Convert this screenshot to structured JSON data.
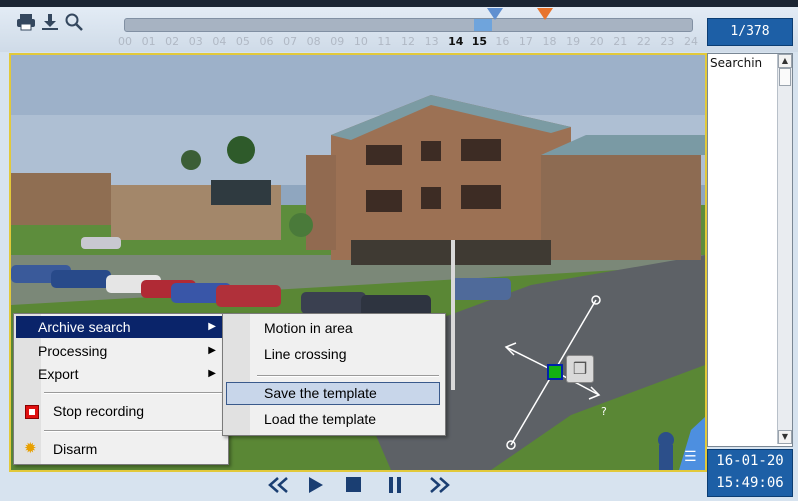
{
  "toolbar": {
    "icons": [
      "print-icon",
      "download-icon",
      "search-icon"
    ]
  },
  "timeline": {
    "hours": [
      "00",
      "01",
      "02",
      "03",
      "04",
      "05",
      "06",
      "07",
      "08",
      "09",
      "10",
      "11",
      "12",
      "13",
      "14",
      "15",
      "16",
      "17",
      "18",
      "19",
      "20",
      "21",
      "22",
      "23",
      "24"
    ],
    "highlighted_hours": [
      "14",
      "15"
    ],
    "marker_blue_color": "#5f8fd0",
    "marker_orange_color": "#e8742c"
  },
  "counter": {
    "value": "1/378"
  },
  "search_panel": {
    "text": "Searchin"
  },
  "datetime": {
    "date": "16-01-20",
    "time": "15:49:06"
  },
  "controls": {
    "icons": [
      "rewind-icon",
      "play-icon",
      "stop-icon",
      "pause-icon",
      "fast-forward-icon"
    ]
  },
  "context_menu": {
    "items": {
      "archive_search": "Archive search",
      "processing": "Processing",
      "export": "Export",
      "stop_recording": "Stop recording",
      "disarm": "Disarm"
    },
    "active_color": "#0a246a"
  },
  "submenu": {
    "items": {
      "motion_in_area": "Motion in area",
      "line_crossing": "Line crossing",
      "save_template": "Save the template",
      "load_template": "Load the template"
    }
  }
}
